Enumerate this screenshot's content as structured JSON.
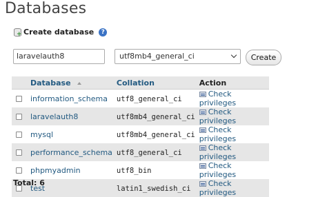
{
  "page_title": "Databases",
  "create_section": {
    "heading": "Create database",
    "help_icon": "?",
    "name_value": "laravelauth8",
    "collation_value": "utf8mb4_general_ci",
    "create_label": "Create"
  },
  "table": {
    "headers": {
      "database": "Database",
      "collation": "Collation",
      "action": "Action"
    },
    "rows": [
      {
        "name": "information_schema",
        "collation": "utf8_general_ci",
        "action": "Check privileges"
      },
      {
        "name": "laravelauth8",
        "collation": "utf8mb4_general_ci",
        "action": "Check privileges"
      },
      {
        "name": "mysql",
        "collation": "utf8mb4_general_ci",
        "action": "Check privileges"
      },
      {
        "name": "performance_schema",
        "collation": "utf8_general_ci",
        "action": "Check privileges"
      },
      {
        "name": "phpmyadmin",
        "collation": "utf8_bin",
        "action": "Check privileges"
      },
      {
        "name": "test",
        "collation": "latin1_swedish_ci",
        "action": "Check privileges"
      }
    ]
  },
  "total_label": "Total: 6",
  "colors": {
    "link": "#235a81",
    "row_alt": "#e6e6e6",
    "header_bg": "#e6e6e6"
  }
}
